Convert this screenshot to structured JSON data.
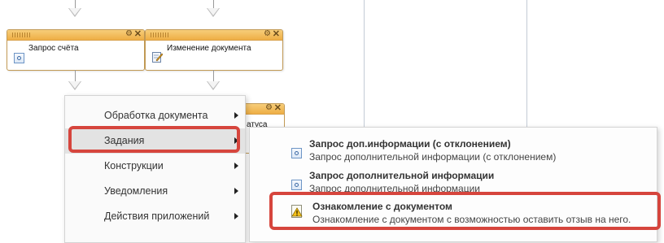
{
  "diagram": {
    "blocks": [
      {
        "title": "Запрос счёта",
        "icon": "process-task-icon"
      },
      {
        "title": "Изменение документа",
        "icon": "edit-document-icon"
      },
      {
        "title": "атуса",
        "icon": "none"
      }
    ]
  },
  "context_menu": {
    "items": [
      {
        "label": "Обработка документа",
        "has_submenu": true
      },
      {
        "label": "Задания",
        "has_submenu": true,
        "active": true
      },
      {
        "label": "Конструкции",
        "has_submenu": true
      },
      {
        "label": "Уведомления",
        "has_submenu": true
      },
      {
        "label": "Действия приложений",
        "has_submenu": true
      }
    ]
  },
  "submenu": {
    "items": [
      {
        "title": "Запрос доп.информации (с отклонением)",
        "description": "Запрос дополнительной информации (с отклонением)",
        "icon": "task-icon"
      },
      {
        "title": "Запрос дополнительной информации",
        "description": "Запрос дополнительной информации",
        "icon": "task-icon"
      },
      {
        "title": "Ознакомление с документом",
        "description": "Ознакомление с документом с возможностью оставить отзыв на него.",
        "icon": "warning-document-icon"
      }
    ]
  },
  "colors": {
    "block_header": "#eeae45",
    "block_border": "#c29a55",
    "annotation": "#d6453d",
    "menu_active": "#e3e3e3"
  }
}
